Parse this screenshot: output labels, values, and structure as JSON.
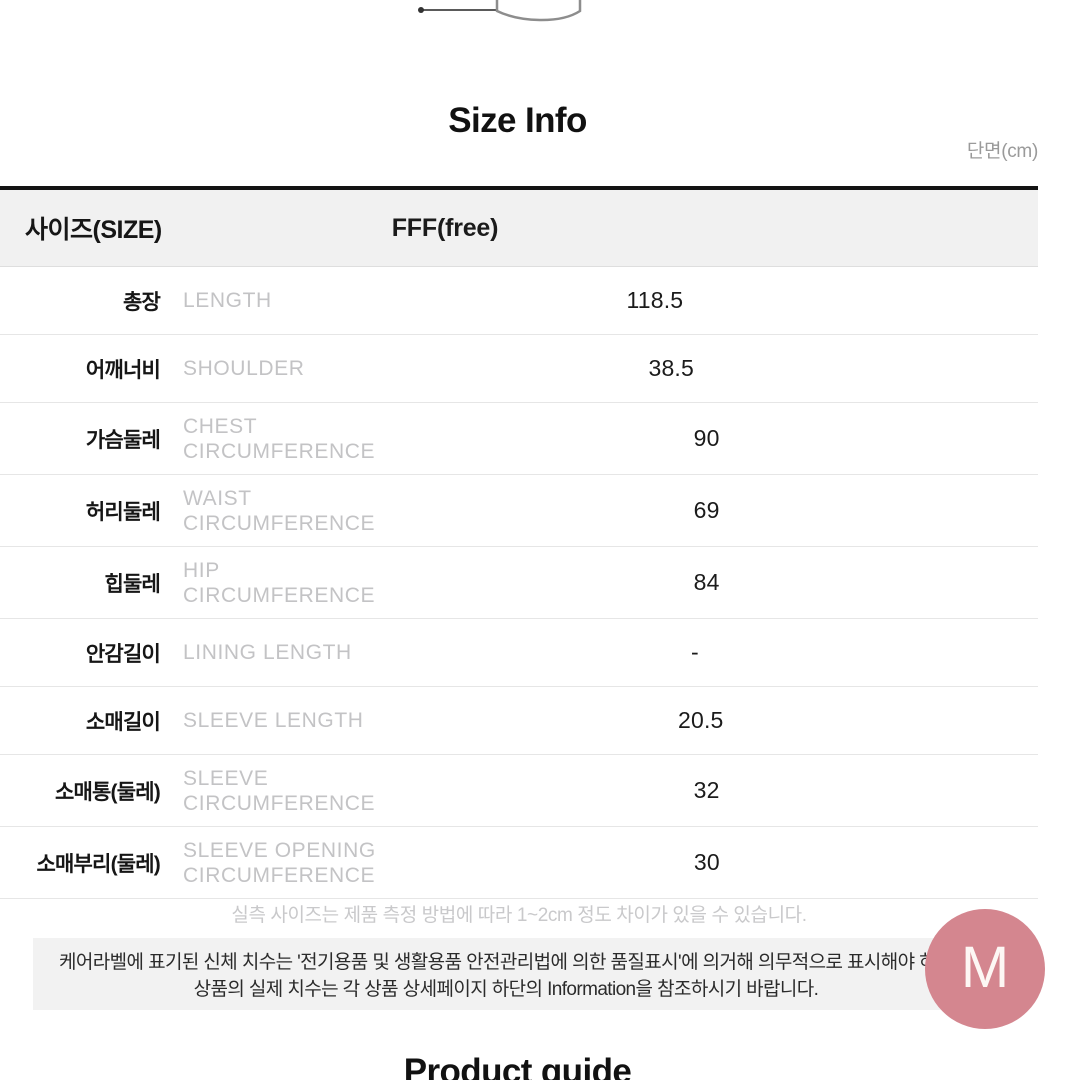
{
  "header": {
    "title": "Size Info",
    "unit_note": "단면(cm)"
  },
  "table": {
    "columns": {
      "size_label": "사이즈(SIZE)",
      "value_label": "FFF(free)"
    },
    "rows": [
      {
        "ko": "총장",
        "en_line1": "LENGTH",
        "en_line2": "",
        "value": "118.5"
      },
      {
        "ko": "어깨너비",
        "en_line1": "SHOULDER",
        "en_line2": "",
        "value": "38.5"
      },
      {
        "ko": "가슴둘레",
        "en_line1": "CHEST",
        "en_line2": "CIRCUMFERENCE",
        "value": "90"
      },
      {
        "ko": "허리둘레",
        "en_line1": "WAIST",
        "en_line2": "CIRCUMFERENCE",
        "value": "69"
      },
      {
        "ko": "힙둘레",
        "en_line1": "HIP",
        "en_line2": "CIRCUMFERENCE",
        "value": "84"
      },
      {
        "ko": "안감길이",
        "en_line1": "LINING LENGTH",
        "en_line2": "",
        "value": "-"
      },
      {
        "ko": "소매길이",
        "en_line1": "SLEEVE LENGTH",
        "en_line2": "",
        "value": "20.5"
      },
      {
        "ko": "소매통(둘레)",
        "en_line1": "SLEEVE",
        "en_line2": "CIRCUMFERENCE",
        "value": "32"
      },
      {
        "ko": "소매부리(둘레)",
        "en_line1": "SLEEVE OPENING",
        "en_line2": "CIRCUMFERENCE",
        "value": "30"
      }
    ]
  },
  "disclaimer": "실측 사이즈는 제품 측정 방법에 따라 1~2cm 정도 차이가 있을 수 있습니다.",
  "notice": {
    "line1": "케어라벨에 표기된 신체 치수는 '전기용품 및 생활용품 안전관리법에 의한 품질표시'에 의거해 의무적으로 표시해야 하는",
    "line2": "상품의 실제 치수는 각 상품 상세페이지 하단의 Information을 참조하시기 바랍니다."
  },
  "badge": {
    "letter": "M",
    "color": "#d4868f"
  },
  "bottom_heading": "Product guide",
  "colors": {
    "table_top_border": "#131313",
    "header_bg": "#f1f1f1",
    "row_divider": "#e6e6e6",
    "english_label": "#c3c3c5",
    "notice_bg": "#f2f2f2"
  }
}
